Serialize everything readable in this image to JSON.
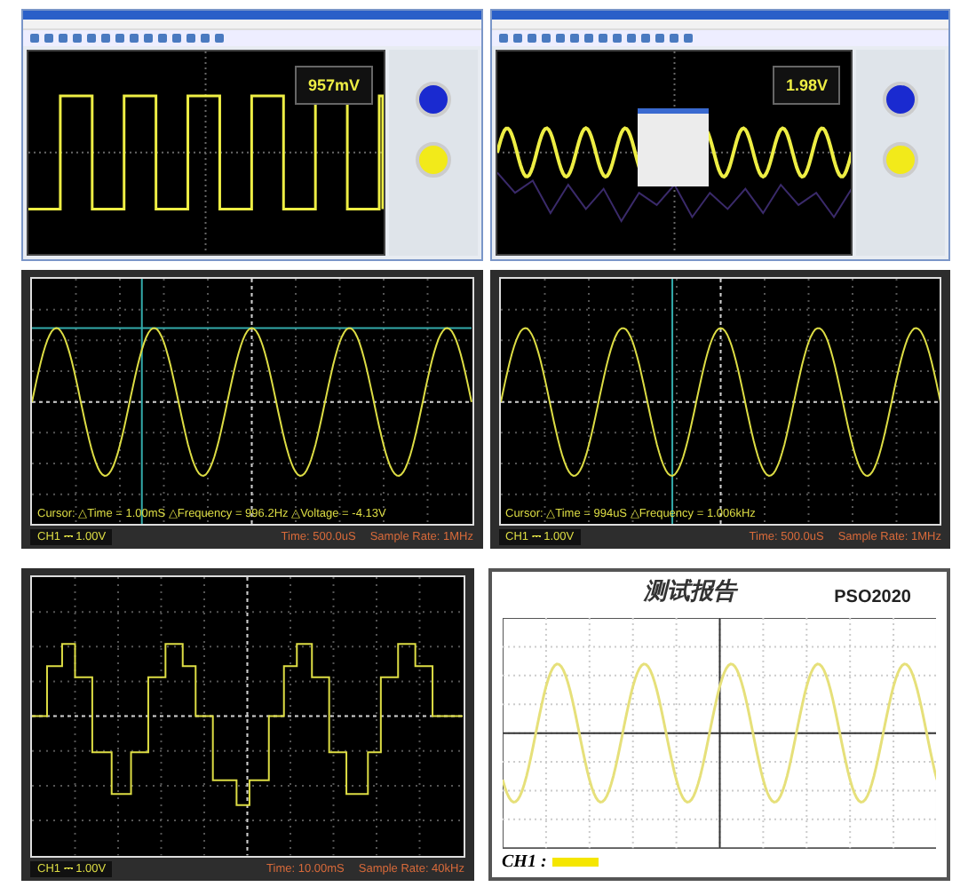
{
  "app_windows": [
    {
      "readout": "957mV"
    },
    {
      "readout": "1.98V"
    }
  ],
  "scope_screens": [
    {
      "cursor_readout": "Cursor: △Time = 1.00mS △Frequency = 996.2Hz △Voltage = -4.13V",
      "channel": "CH1 ⎓ 1.00V",
      "timebase": "Time: 500.0uS",
      "sample_rate": "Sample Rate: 1MHz"
    },
    {
      "cursor_readout": "Cursor: △Time = 994uS △Frequency = 1.006kHz",
      "channel": "CH1 ⎓ 1.00V",
      "timebase": "Time: 500.0uS",
      "sample_rate": "Sample Rate: 1MHz"
    },
    {
      "channel": "CH1 ⎓ 1.00V",
      "timebase": "Time: 10.00mS",
      "sample_rate": "Sample Rate: 40kHz"
    }
  ],
  "report": {
    "title": "测试报告",
    "model": "PSO2020",
    "channel_label": "CH1 :"
  }
}
